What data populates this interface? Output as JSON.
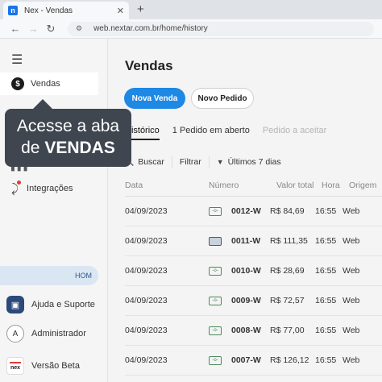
{
  "browser": {
    "tab_title": "Nex - Vendas",
    "tab_favicon": "n",
    "close_glyph": "✕",
    "new_tab_glyph": "+",
    "url": "web.nextar.com.br/home/history"
  },
  "sidebar": {
    "active_item": "Vendas",
    "integrations_label": "Integrações",
    "env_badge": "HOM",
    "help_label": "Ajuda e Suporte",
    "admin_label": "Administrador",
    "admin_initial": "A",
    "beta_label": "Versão Beta",
    "beta_logo_text": "nex"
  },
  "callout": {
    "line1": "Acesse a aba",
    "line2_prefix": "de ",
    "line2_bold": "VENDAS"
  },
  "main": {
    "title": "Vendas",
    "primary_button": "Nova Venda",
    "secondary_button": "Novo Pedido",
    "tabs": [
      "Histórico",
      "1 Pedido em aberto",
      "Pedido a aceitar"
    ],
    "filters": {
      "search": "Buscar",
      "filter": "Filtrar",
      "period": "Últimos 7 dias"
    },
    "columns": [
      "Data",
      "Número",
      "Valor total",
      "Hora",
      "Origem"
    ],
    "rows": [
      {
        "date": "04/09/2023",
        "icon": "cash-icon",
        "number": "0012-W",
        "total": "R$ 84,69",
        "time": "16:55",
        "origin": "Web"
      },
      {
        "date": "04/09/2023",
        "icon": "card-icon",
        "number": "0011-W",
        "total": "R$ 111,35",
        "time": "16:55",
        "origin": "Web"
      },
      {
        "date": "04/09/2023",
        "icon": "cash-icon",
        "number": "0010-W",
        "total": "R$ 28,69",
        "time": "16:55",
        "origin": "Web"
      },
      {
        "date": "04/09/2023",
        "icon": "cash-icon",
        "number": "0009-W",
        "total": "R$ 72,57",
        "time": "16:55",
        "origin": "Web"
      },
      {
        "date": "04/09/2023",
        "icon": "cash-icon",
        "number": "0008-W",
        "total": "R$ 77,00",
        "time": "16:55",
        "origin": "Web"
      },
      {
        "date": "04/09/2023",
        "icon": "cash-icon",
        "number": "0007-W",
        "total": "R$ 126,12",
        "time": "16:55",
        "origin": "Web"
      }
    ]
  },
  "colors": {
    "primary": "#1e88e5",
    "callout": "#3f4650",
    "badge": "#dbe6f3"
  }
}
